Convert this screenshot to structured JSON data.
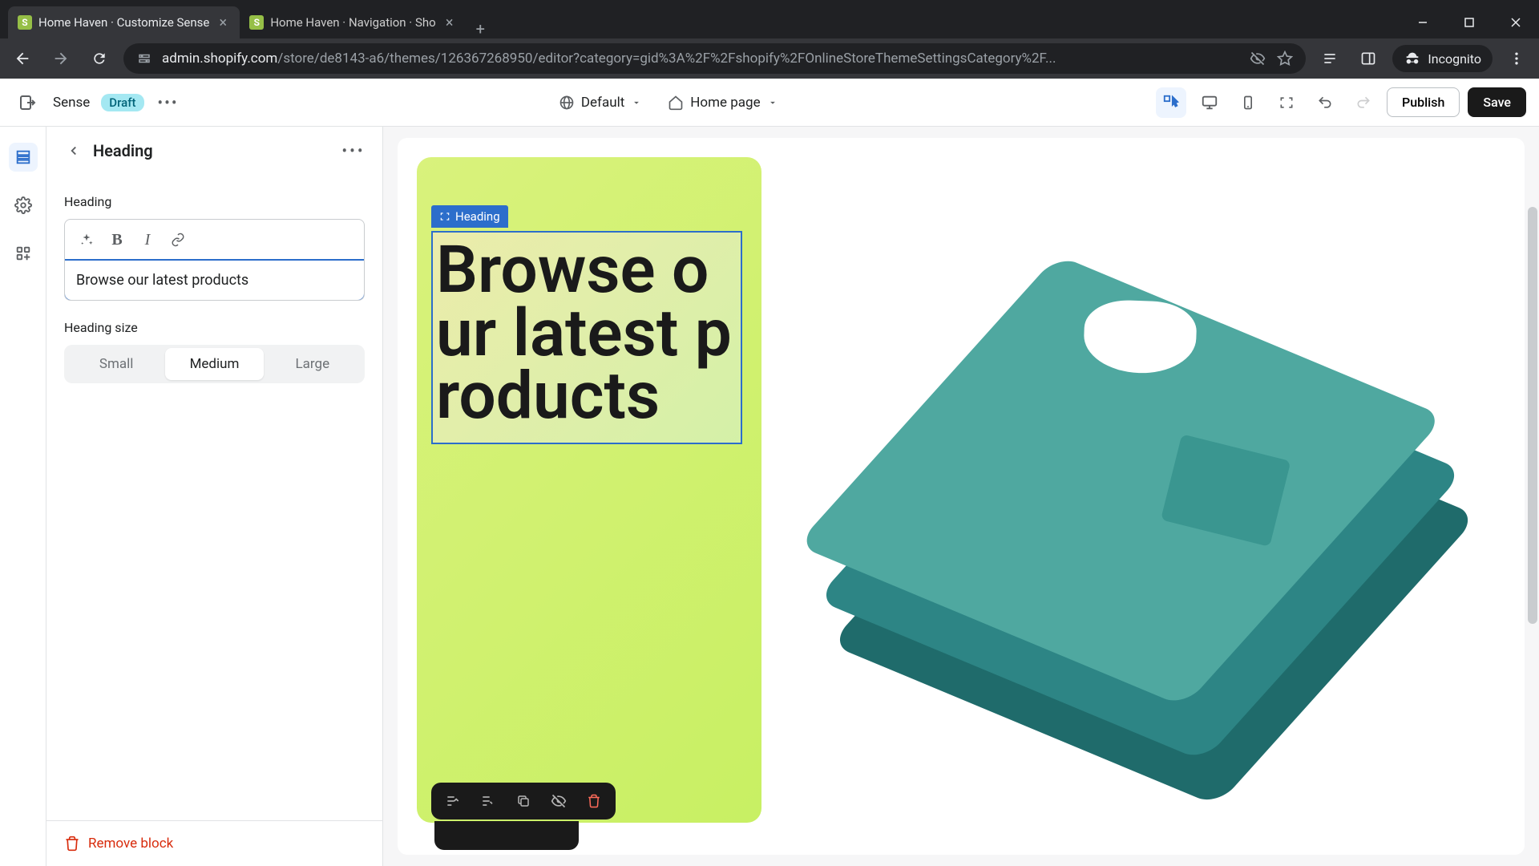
{
  "browser": {
    "tabs": [
      {
        "title": "Home Haven · Customize Sense",
        "active": true
      },
      {
        "title": "Home Haven · Navigation · Sho",
        "active": false
      }
    ],
    "url_host": "admin.shopify.com",
    "url_path": "/store/de8143-a6/themes/126367268950/editor?category=gid%3A%2F%2Fshopify%2FOnlineStoreThemeSettingsCategory%2F...",
    "incognito_label": "Incognito"
  },
  "appbar": {
    "theme_name": "Sense",
    "draft_label": "Draft",
    "template_dropdown": "Default",
    "page_dropdown": "Home page",
    "publish_label": "Publish",
    "save_label": "Save"
  },
  "sidebar": {
    "panel_title": "Heading",
    "field_heading_label": "Heading",
    "heading_value": "Browse our latest products",
    "heading_size_label": "Heading size",
    "sizes": {
      "small": "Small",
      "medium": "Medium",
      "large": "Large"
    },
    "size_active": "medium",
    "remove_label": "Remove block"
  },
  "preview": {
    "badge_label": "Heading",
    "heading_rendered": "Browse our latest products"
  }
}
